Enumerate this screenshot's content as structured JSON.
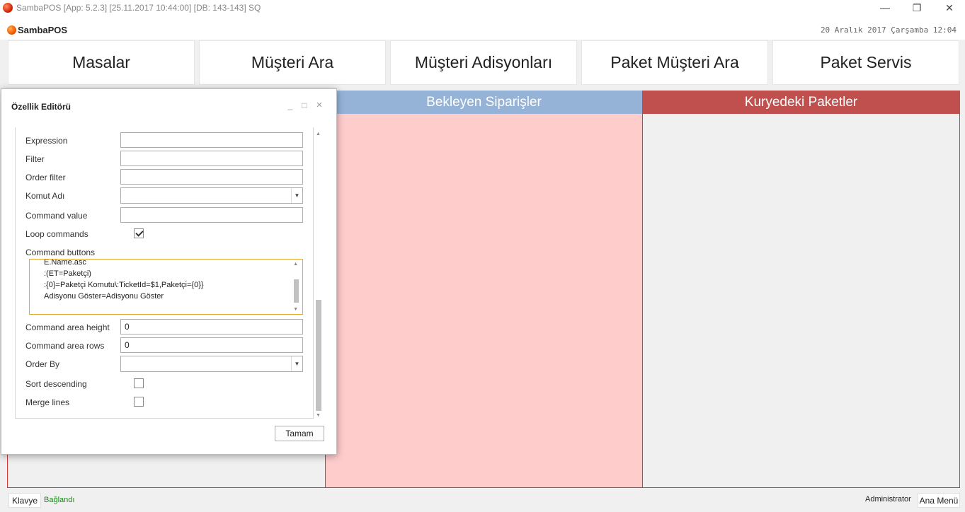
{
  "window": {
    "title": "SambaPOS [App: 5.2.3] [25.11.2017 10:44:00] [DB: 143-143] SQ",
    "minimize_glyph": "—",
    "restore_glyph": "❐",
    "close_glyph": "✕"
  },
  "header": {
    "logo_text": "SambaPOS",
    "datetime": "20 Aralık 2017 Çarşamba 12:04"
  },
  "nav": {
    "buttons": [
      "Masalar",
      "Müşteri Ara",
      "Müşteri Adisyonları",
      "Paket Müşteri Ara",
      "Paket Servis"
    ]
  },
  "panels": {
    "pending_title": "Bekleyen Siparişler",
    "courier_title": "Kuryedeki Paketler",
    "colors": {
      "blue_header": "#95b3d7",
      "red_header": "#c0504d",
      "pink_body": "#ffcccc",
      "border": "#d43a3a"
    }
  },
  "dialog": {
    "title": "Özellik Editörü",
    "minimize_glyph": "_",
    "maximize_glyph": "□",
    "close_glyph": "×",
    "fields": {
      "expression": {
        "label": "Expression",
        "value": ""
      },
      "filter": {
        "label": "Filter",
        "value": ""
      },
      "order_filter": {
        "label": "Order filter",
        "value": ""
      },
      "komut_adi": {
        "label": "Komut Adı",
        "value": ""
      },
      "command_value": {
        "label": "Command value",
        "value": ""
      },
      "loop_commands": {
        "label": "Loop commands",
        "checked": true
      },
      "command_buttons": {
        "label": "Command buttons",
        "lines": [
          "E.Name.asc",
          ":(ET=Paketçi)",
          ":{0}=Paketçi Komutu\\:TicketId=$1,Paketçi={0}}",
          "Adisyonu Göster=Adisyonu Göster"
        ]
      },
      "command_area_height": {
        "label": "Command area height",
        "value": "0"
      },
      "command_area_rows": {
        "label": "Command area rows",
        "value": "0"
      },
      "order_by": {
        "label": "Order By",
        "value": ""
      },
      "sort_descending": {
        "label": "Sort descending",
        "checked": false
      },
      "merge_lines": {
        "label": "Merge lines",
        "checked": false
      }
    },
    "ok_label": "Tamam"
  },
  "statusbar": {
    "keyboard_label": "Klavye",
    "connection_status": "Bağlandı",
    "user": "Administrator",
    "main_menu_label": "Ana Menü"
  }
}
